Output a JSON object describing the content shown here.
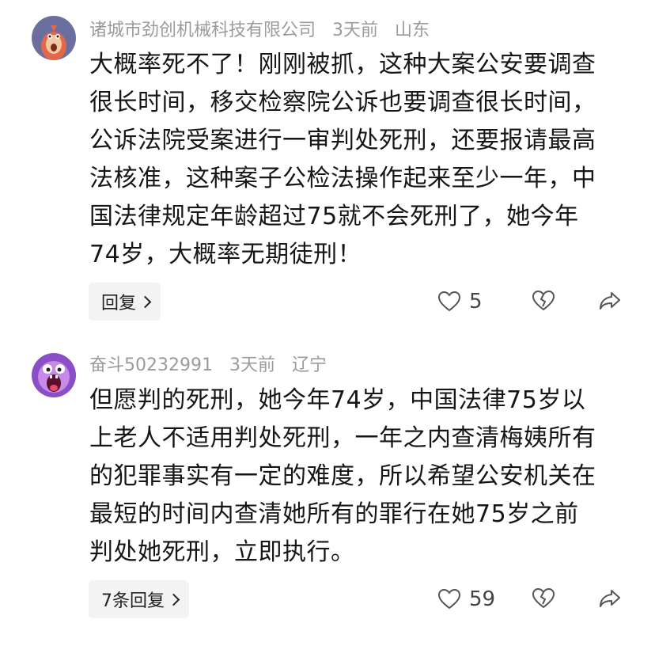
{
  "comments": [
    {
      "author": "诸城市劲创机械科技有限公司",
      "time": "3天前",
      "location": "山东",
      "avatar_icon": "cartoon-creature-avatar",
      "body_lines": [
        "大概率死不了！刚刚被抓，这种大案公安要调查",
        "很长时间，移交检察院公诉也要调查很长时间，",
        "公诉法院受案进行一审判处死刑，还要报请最高",
        "法核准，这种案子公检法操作起来至少一年，中",
        "国法律规定年龄超过75就不会死刑了，她今年",
        "74岁，大概率无期徒刑！"
      ],
      "reply_label": "回复",
      "like_count": "5"
    },
    {
      "author": "奋斗50232991",
      "time": "3天前",
      "location": "辽宁",
      "avatar_icon": "screaming-monster-avatar",
      "body_lines": [
        "但愿判的死刑，她今年74岁，中国法律75岁以",
        "上老人不适用判处死刑，一年之内查清梅姨所有",
        "的犯罪事实有一定的难度，所以希望公安机关在",
        "最短的时间内查清她所有的罪行在她75岁之前",
        "判处她死刑，立即执行。"
      ],
      "reply_label": "7条回复",
      "like_count": "59"
    }
  ],
  "icons": {
    "like": "heart-outline-icon",
    "dislike": "broken-heart-icon",
    "share": "share-arrow-icon",
    "reply_chevron": "chevron-right-icon"
  },
  "colors": {
    "meta_text": "#9b9b9b",
    "body_text": "#161616",
    "reply_bg": "#f3f3f3",
    "icon": "#555555",
    "avatar1_bg": "#6b6fa0",
    "avatar2_bg": "#8a4fc7"
  }
}
